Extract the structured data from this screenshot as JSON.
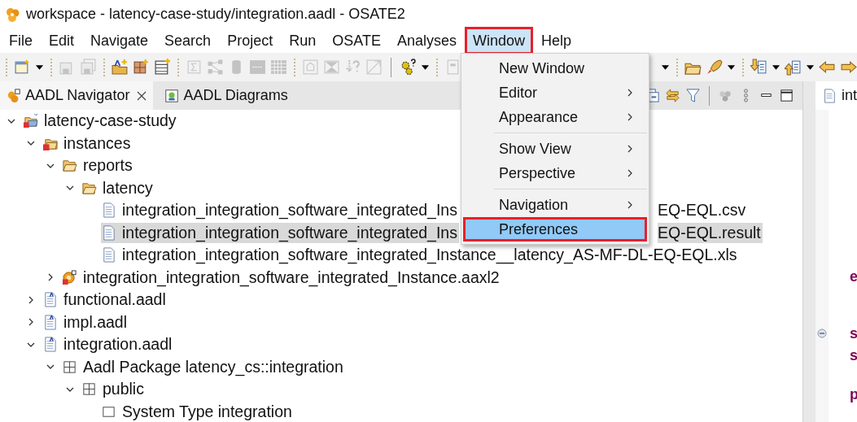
{
  "window": {
    "title": "workspace - latency-case-study/integration.aadl - OSATE2"
  },
  "menu_bar": [
    {
      "label": "File",
      "selected": false,
      "highlight_box": false
    },
    {
      "label": "Edit",
      "selected": false,
      "highlight_box": false
    },
    {
      "label": "Navigate",
      "selected": false,
      "highlight_box": false
    },
    {
      "label": "Search",
      "selected": false,
      "highlight_box": false
    },
    {
      "label": "Project",
      "selected": false,
      "highlight_box": false
    },
    {
      "label": "Run",
      "selected": false,
      "highlight_box": false
    },
    {
      "label": "OSATE",
      "selected": false,
      "highlight_box": false
    },
    {
      "label": "Analyses",
      "selected": false,
      "highlight_box": false
    },
    {
      "label": "Window",
      "selected": true,
      "highlight_box": true
    },
    {
      "label": "Help",
      "selected": false,
      "highlight_box": false
    }
  ],
  "toolbar": [
    {
      "kind": "new-window",
      "disabled": false
    },
    {
      "kind": "caret",
      "disabled": false
    },
    {
      "kind": "separator"
    },
    {
      "kind": "save",
      "disabled": true
    },
    {
      "kind": "save-all",
      "disabled": true
    },
    {
      "kind": "separator"
    },
    {
      "kind": "folder-plus",
      "disabled": false
    },
    {
      "kind": "grid-plus",
      "disabled": false
    },
    {
      "kind": "table-plus",
      "disabled": false
    },
    {
      "kind": "separator"
    },
    {
      "kind": "sigma",
      "disabled": true
    },
    {
      "kind": "network",
      "disabled": true
    },
    {
      "kind": "cylinder",
      "disabled": true
    },
    {
      "kind": "panel",
      "disabled": true
    },
    {
      "kind": "grid",
      "disabled": true
    },
    {
      "kind": "separator"
    },
    {
      "kind": "frame",
      "disabled": true
    },
    {
      "kind": "hourglass",
      "disabled": true
    },
    {
      "kind": "question-arrow",
      "disabled": true
    },
    {
      "kind": "resize",
      "disabled": true
    },
    {
      "kind": "divider"
    },
    {
      "kind": "gear-question",
      "disabled": false
    },
    {
      "kind": "caret",
      "disabled": false
    },
    {
      "kind": "separator"
    },
    {
      "kind": "document",
      "disabled": true
    }
  ],
  "toolbar_right": [
    {
      "kind": "caret",
      "disabled": false
    },
    {
      "kind": "separator"
    },
    {
      "kind": "folder",
      "disabled": false
    },
    {
      "kind": "rocket",
      "disabled": false
    },
    {
      "kind": "caret",
      "disabled": false
    },
    {
      "kind": "separator"
    },
    {
      "kind": "down-document",
      "disabled": false
    },
    {
      "kind": "caret",
      "disabled": false
    },
    {
      "kind": "up-document",
      "disabled": false
    },
    {
      "kind": "caret",
      "disabled": false
    },
    {
      "kind": "back-arrow",
      "disabled": false
    },
    {
      "kind": "forward-arrow",
      "disabled": false
    }
  ],
  "navigator": {
    "tabs": [
      {
        "label": "AADL Navigator",
        "selected": true,
        "closable": true
      },
      {
        "label": "AADL Diagrams",
        "selected": false,
        "closable": false
      }
    ],
    "tree": [
      {
        "kind": "project",
        "label": "latency-case-study",
        "expanded": true,
        "selected": false,
        "children": [
          {
            "kind": "instances",
            "label": "instances",
            "expanded": true,
            "selected": false,
            "children": [
              {
                "kind": "folder",
                "label": "reports",
                "expanded": true,
                "selected": false,
                "children": [
                  {
                    "kind": "folder",
                    "label": "latency",
                    "expanded": true,
                    "selected": false,
                    "children": [
                      {
                        "kind": "file",
                        "label": "integration_integration_software_integrated_Ins",
                        "label_tail": "EQ-EQL.csv",
                        "selected": false
                      },
                      {
                        "kind": "file",
                        "label": "integration_integration_software_integrated_Ins",
                        "label_tail": "EQ-EQL.result",
                        "selected": true
                      },
                      {
                        "kind": "file",
                        "label": "integration_integration_software_integrated_Instance__latency_AS-MF-DL-EQ-EQL.xls",
                        "selected": false
                      }
                    ]
                  }
                ]
              },
              {
                "kind": "instance-model",
                "label": "integration_integration_software_integrated_Instance.aaxl2",
                "expanded": false,
                "selected": false
              }
            ]
          },
          {
            "kind": "aadl",
            "label": "functional.aadl",
            "expanded": false,
            "selected": false
          },
          {
            "kind": "aadl",
            "label": "impl.aadl",
            "expanded": false,
            "selected": false
          },
          {
            "kind": "aadl",
            "label": "integration.aadl",
            "expanded": true,
            "selected": false,
            "children": [
              {
                "kind": "package",
                "label": "Aadl Package latency_cs::integration",
                "expanded": true,
                "selected": false,
                "children": [
                  {
                    "kind": "section",
                    "label": "public",
                    "expanded": true,
                    "selected": false,
                    "children": [
                      {
                        "kind": "type",
                        "label": "System Type integration",
                        "selected": false
                      }
                    ]
                  }
                ]
              }
            ]
          }
        ]
      }
    ]
  },
  "editor": {
    "tab": {
      "label": "int"
    },
    "lines": [
      {
        "text": "e",
        "foldable": false
      },
      {
        "text": "s",
        "foldable": true
      },
      {
        "text": "s",
        "foldable": false
      },
      {
        "text": "p",
        "foldable": false
      }
    ]
  },
  "window_menu": {
    "groups": [
      [
        {
          "label": "New Window",
          "submenu": false,
          "selected": false,
          "highlight_box": false
        },
        {
          "label": "Editor",
          "submenu": true,
          "selected": false,
          "highlight_box": false
        },
        {
          "label": "Appearance",
          "submenu": true,
          "selected": false,
          "highlight_box": false
        }
      ],
      [
        {
          "label": "Show View",
          "submenu": true,
          "selected": false,
          "highlight_box": false
        },
        {
          "label": "Perspective",
          "submenu": true,
          "selected": false,
          "highlight_box": false
        }
      ],
      [
        {
          "label": "Navigation",
          "submenu": true,
          "selected": false,
          "highlight_box": false
        },
        {
          "label": "Preferences",
          "submenu": false,
          "selected": true,
          "highlight_box": true
        }
      ]
    ]
  }
}
